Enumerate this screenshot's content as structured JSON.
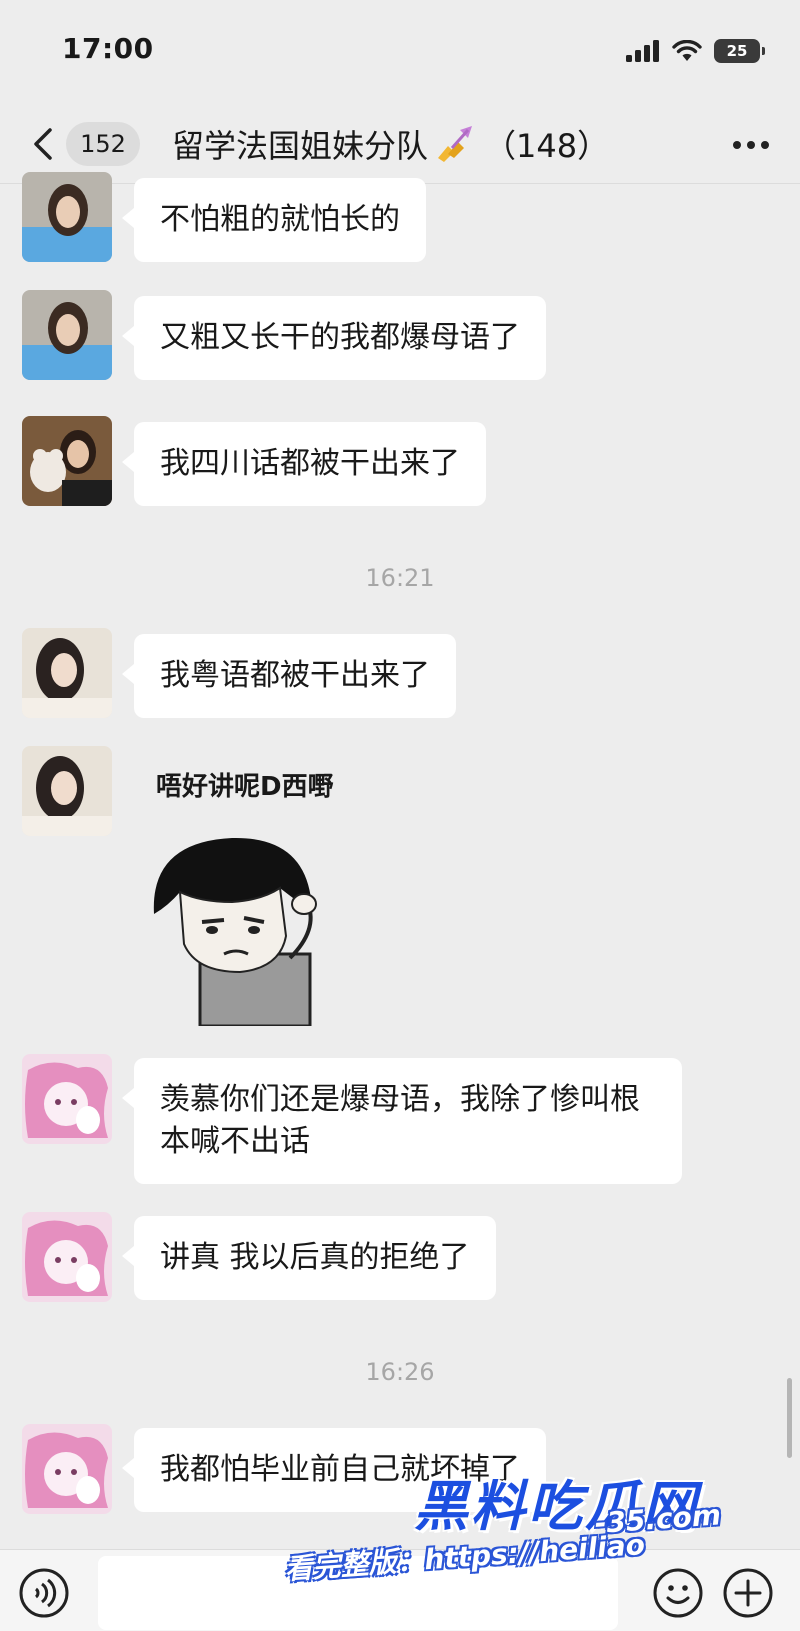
{
  "status_bar": {
    "time": "17:00",
    "battery": "25",
    "icons": [
      "signal-icon",
      "wifi-icon",
      "battery-icon"
    ]
  },
  "nav": {
    "back_icon": "chevron-left-icon",
    "unread_count": "152",
    "title": "留学法国姐妹分队",
    "title_emoji": "nail-polish-icon",
    "member_count": "（148）",
    "more_icon": "more-icon"
  },
  "messages": [
    {
      "text": "不怕粗的就怕长的",
      "avatar": "avatar-blue-top-girl"
    },
    {
      "text": "又粗又长干的我都爆母语了",
      "avatar": "avatar-blue-top-girl"
    },
    {
      "text": "我四川话都被干出来了",
      "avatar": "avatar-teddy-bear-girl"
    },
    {
      "text": "我粤语都被干出来了",
      "avatar": "avatar-pale-girl"
    },
    {
      "text": "羡慕你们还是爆母语，我除了惨叫根本喊不出话",
      "avatar": "avatar-pink-cartoon"
    },
    {
      "text": "讲真 我以后真的拒绝了",
      "avatar": "avatar-pink-cartoon"
    },
    {
      "text": "我都怕毕业前自己就坏掉了",
      "avatar": "avatar-pink-cartoon"
    }
  ],
  "timestamps": [
    "16:21",
    "16:26"
  ],
  "sticker": {
    "caption": "唔好讲呢D西嘢",
    "icon": "mushroom-head-meme-sticker"
  },
  "input_bar": {
    "voice_icon": "voice-icon",
    "emoji_icon": "emoji-icon",
    "plus_icon": "plus-icon"
  },
  "watermark": {
    "logo": "黑料吃瓜网",
    "url_prefix": "看完整版：https://heiliao",
    "url_suffix": "-35.com"
  },
  "colors": {
    "background": "#ededed",
    "bubble": "#ffffff",
    "timestamp": "#a6a6a6",
    "watermark_blue": "#1c4fe0"
  }
}
